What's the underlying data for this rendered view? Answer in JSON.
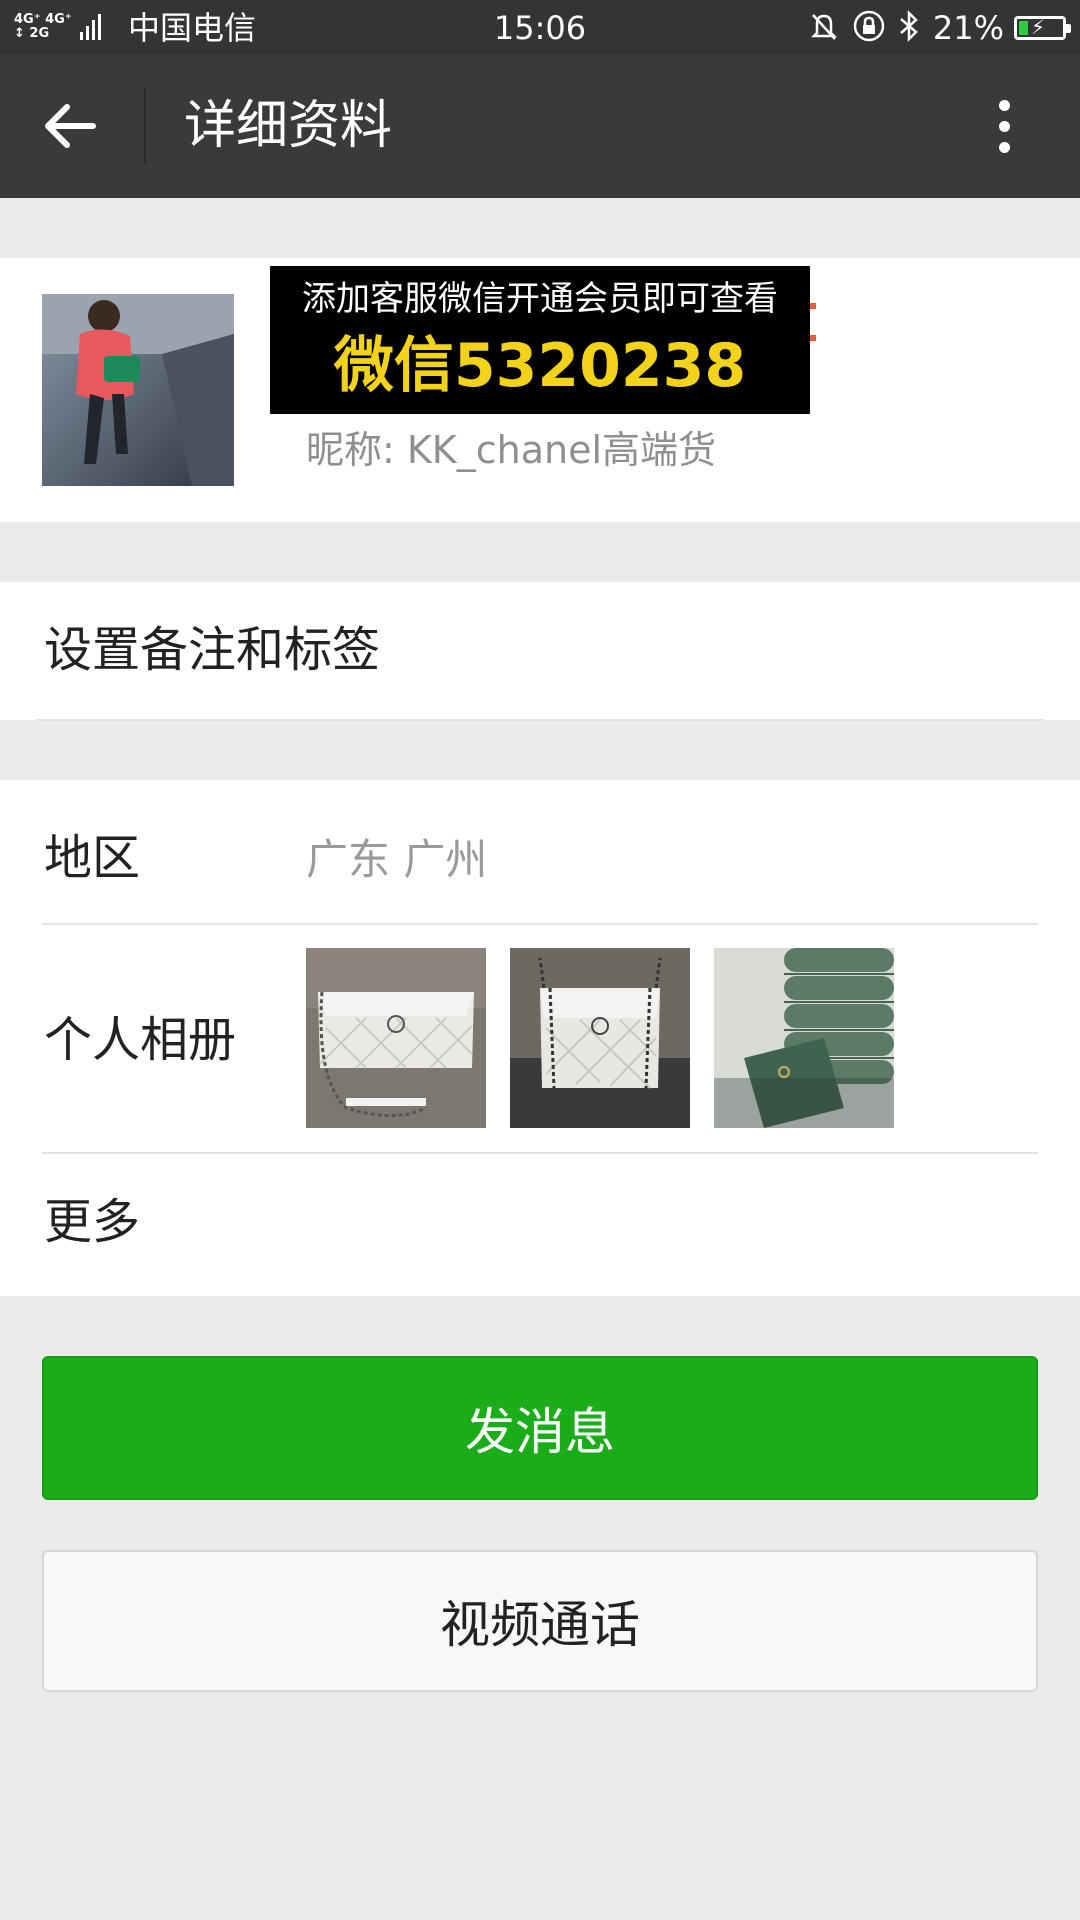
{
  "status_bar": {
    "network_top": "4G⁺ 4G⁺",
    "network_bottom": "↕ 2G",
    "carrier": "中国电信",
    "time": "15:06",
    "battery": "21%",
    "battery_level": 0.21,
    "battery_color": "#2ecc40"
  },
  "header": {
    "title": "详细资料"
  },
  "profile": {
    "nickname_label": "昵称: KK_chanel高端货",
    "promo_line1": "添加客服微信开通会员即可查看",
    "promo_line2": "微信5320238"
  },
  "rows": {
    "remark": "设置备注和标签",
    "region_label": "地区",
    "region_value": "广东  广州",
    "album_label": "个人相册",
    "more_label": "更多"
  },
  "buttons": {
    "send_message": "发消息",
    "video_call": "视频通话"
  },
  "colors": {
    "primary_green": "#1aad19",
    "promo_yellow": "#f3d21a",
    "header_bg": "#393a3c"
  }
}
